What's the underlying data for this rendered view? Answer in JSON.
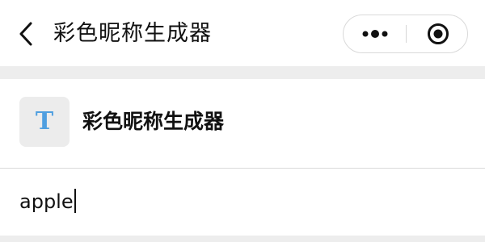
{
  "nav": {
    "title": "彩色昵称生成器",
    "back_icon": "chevron-left-icon",
    "more_icon": "more-dots-icon",
    "close_icon": "target-circle-icon"
  },
  "app": {
    "icon_letter": "T",
    "icon_color": "#4f9fe0",
    "name": "彩色昵称生成器"
  },
  "input": {
    "value": "apple"
  },
  "colors": {
    "page_background": "#ededed",
    "surface": "#ffffff",
    "text": "#111111"
  }
}
